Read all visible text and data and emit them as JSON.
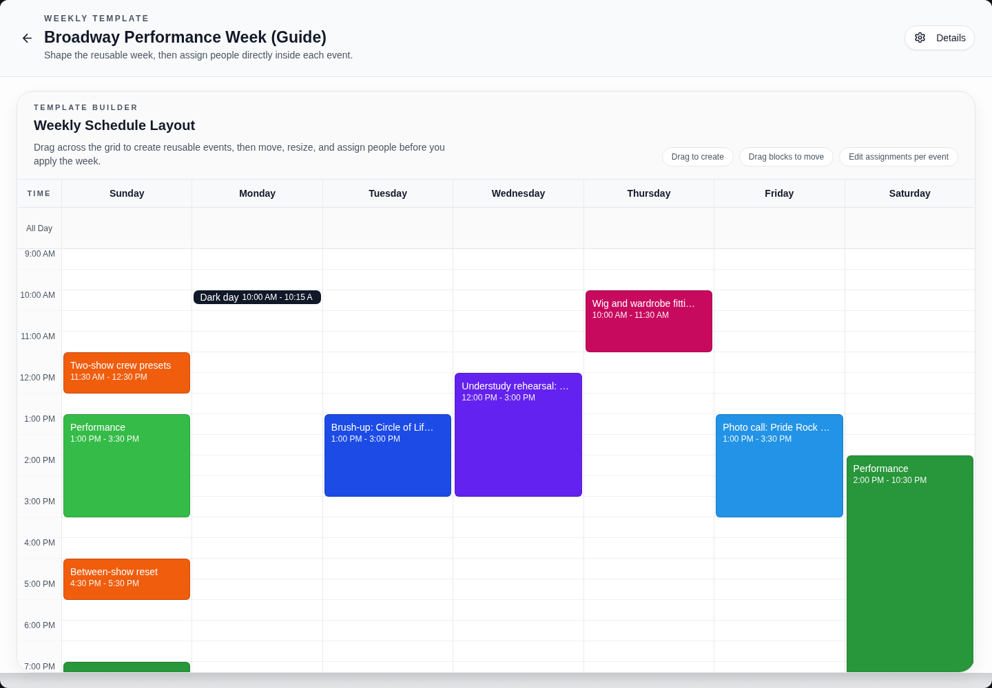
{
  "header": {
    "eyebrow": "WEEKLY TEMPLATE",
    "title": "Broadway Performance Week (Guide)",
    "subtitle": "Shape the reusable week, then assign people directly inside each event.",
    "details_button": "Details"
  },
  "builder": {
    "eyebrow": "TEMPLATE BUILDER",
    "title": "Weekly Schedule Layout",
    "description": "Drag across the grid to create reusable events, then move, resize, and assign people before you apply the week.",
    "hints": [
      "Drag to create",
      "Drag blocks to move",
      "Edit assignments per event"
    ]
  },
  "calendar": {
    "time_heading": "TIME",
    "all_day_label": "All Day",
    "time_labels": [
      "9:00 AM",
      "10:00 AM",
      "11:00 AM",
      "12:00 PM",
      "1:00 PM",
      "2:00 PM",
      "3:00 PM",
      "4:00 PM",
      "5:00 PM",
      "6:00 PM",
      "7:00 PM"
    ],
    "days": [
      {
        "name": "Sunday",
        "events": [
          {
            "kind": "block",
            "title": "Two-show crew presets",
            "time": "11:30 AM - 12:30 PM",
            "color": "#f05d0c"
          },
          {
            "kind": "block",
            "title": "Performance",
            "time": "1:00 PM - 3:30 PM",
            "color": "#35bb48"
          },
          {
            "kind": "block",
            "title": "Between-show reset",
            "time": "4:30 PM - 5:30 PM",
            "color": "#f05d0c"
          },
          {
            "kind": "continued",
            "color": "#28963a"
          }
        ]
      },
      {
        "name": "Monday",
        "events": [
          {
            "kind": "pill",
            "title": "Dark day",
            "time": "10:00 AM - 10:15 A",
            "color": "#111827"
          }
        ]
      },
      {
        "name": "Tuesday",
        "events": [
          {
            "kind": "block",
            "title": "Brush-up: Circle of Lif…",
            "time": "1:00 PM - 3:00 PM",
            "color": "#1c4be6"
          }
        ]
      },
      {
        "name": "Wednesday",
        "events": [
          {
            "kind": "block",
            "title": "Understudy rehearsal: …",
            "time": "12:00 PM - 3:00 PM",
            "color": "#6322ef"
          }
        ]
      },
      {
        "name": "Thursday",
        "events": [
          {
            "kind": "block",
            "title": "Wig and wardrobe fitti…",
            "time": "10:00 AM - 11:30 AM",
            "color": "#c70a5e"
          }
        ]
      },
      {
        "name": "Friday",
        "events": [
          {
            "kind": "block",
            "title": "Photo call: Pride Rock …",
            "time": "1:00 PM - 3:30 PM",
            "color": "#2293e6"
          }
        ]
      },
      {
        "name": "Saturday",
        "events": [
          {
            "kind": "block",
            "title": "Performance",
            "time": "2:00 PM - 10:30 PM",
            "color": "#28963a"
          }
        ]
      }
    ]
  }
}
